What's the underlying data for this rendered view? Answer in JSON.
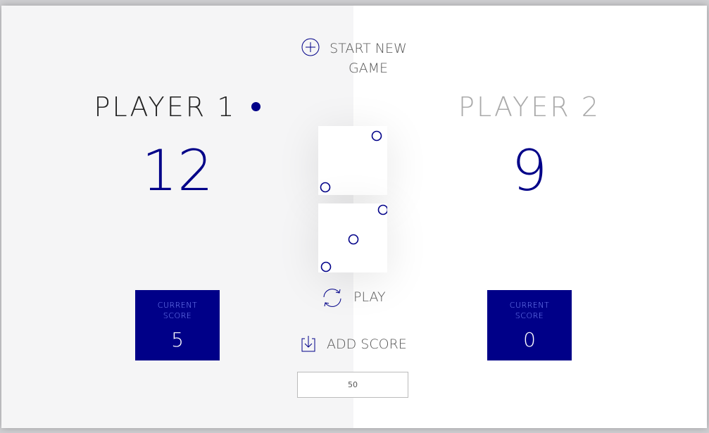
{
  "buttons": {
    "new_game": "START NEW\nGAME",
    "roll": "PLAY",
    "hold": "ADD SCORE"
  },
  "players": [
    {
      "name": "PLAYER 1",
      "score": "12",
      "current_label": "CURRENT SCORE",
      "current_score": "5",
      "active": true
    },
    {
      "name": "PLAYER 2",
      "score": "9",
      "current_label": "CURRENT SCORE",
      "current_score": "0",
      "active": false
    }
  ],
  "dice": [
    {
      "value": 2
    },
    {
      "value": 3
    }
  ],
  "final_score_input": {
    "value": "50"
  },
  "colors": {
    "accent": "#000088",
    "left_panel": "#f5f5f6",
    "right_panel": "#ffffff"
  }
}
